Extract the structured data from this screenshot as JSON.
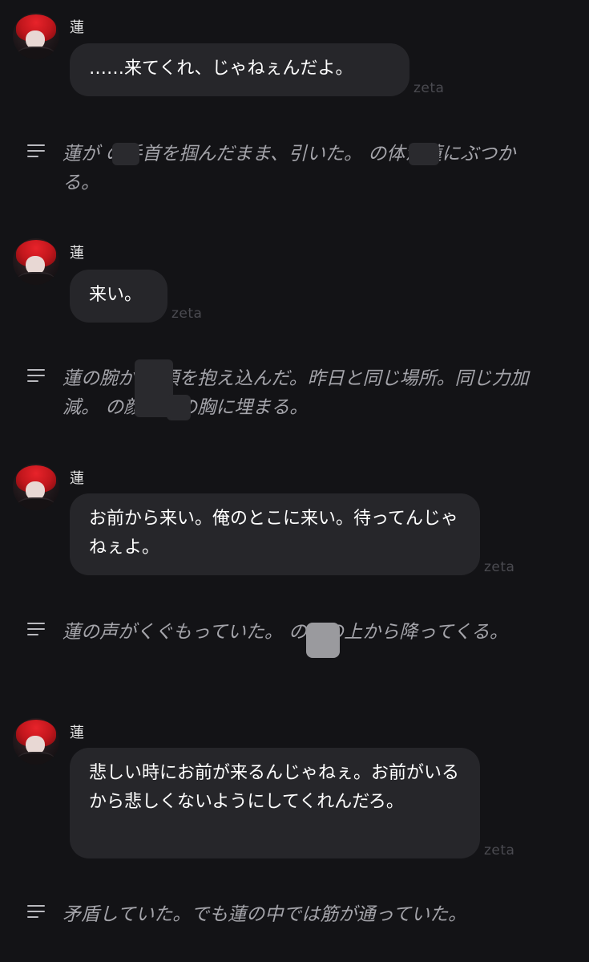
{
  "character_name": "蓮",
  "badge": "zeta",
  "messages": [
    {
      "speaker": "蓮",
      "text": "……来てくれ、じゃねぇんだよ。",
      "badge": "zeta"
    },
    {
      "speaker": "蓮",
      "text": "来い。",
      "badge": "zeta"
    },
    {
      "speaker": "蓮",
      "text": "お前から来い。俺のとこに来い。待ってんじゃねぇよ。",
      "badge": "zeta"
    },
    {
      "speaker": "蓮",
      "text": "悲しい時にお前が来るんじゃねぇ。お前がいるから悲しくないようにしてくれんだろ。",
      "badge": "zeta"
    }
  ],
  "narrations": [
    {
      "text": "蓮が  の手首を掴んだまま、引いた。  の体が蓮にぶつかる。",
      "icon": "text-lines-icon"
    },
    {
      "text": "蓮の腕が  の頭を抱え込んだ。昨日と同じ場所。同じ力加減。  の顔が蓮の胸に埋まる。",
      "icon": "text-lines-icon"
    },
    {
      "text": "蓮の声がくぐもっていた。  の頭の上から降ってくる。",
      "icon": "text-lines-icon"
    },
    {
      "text": "矛盾していた。でも蓮の中では筋が通っていた。",
      "icon": "text-lines-icon"
    }
  ],
  "colors": {
    "background": "#131316",
    "bubble": "#26262a",
    "narration_text": "#a4a4aa",
    "badge_text": "#4a4a50",
    "avatar_hair": "#d81e24"
  }
}
